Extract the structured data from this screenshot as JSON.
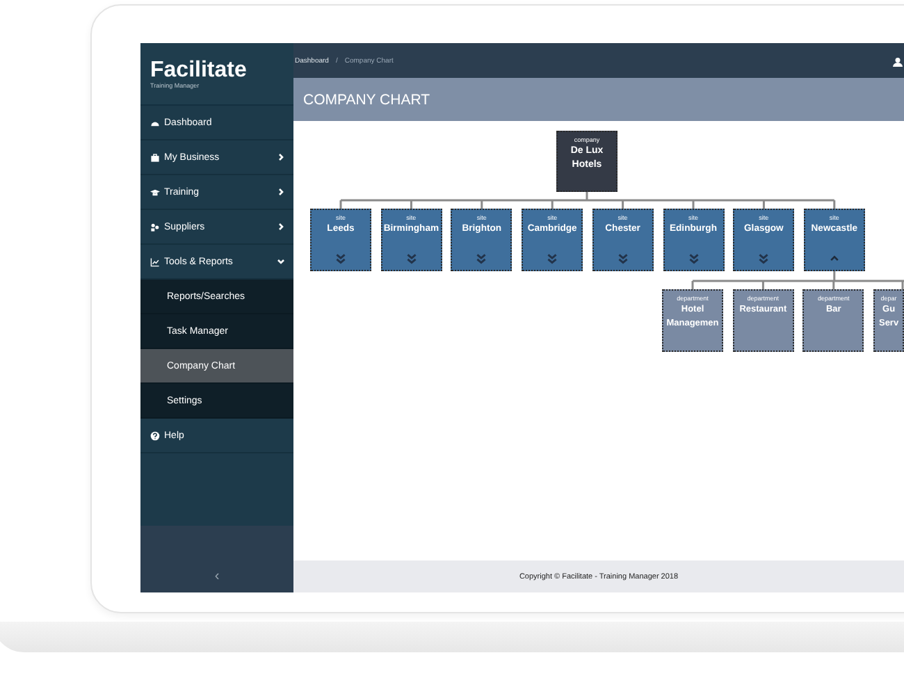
{
  "logo": {
    "name": "Facilitate",
    "subtitle": "Training Manager"
  },
  "sidebar": {
    "items": [
      {
        "label": "Dashboard"
      },
      {
        "label": "My Business",
        "expanded": false
      },
      {
        "label": "Training",
        "expanded": false
      },
      {
        "label": "Suppliers",
        "expanded": false
      },
      {
        "label": "Tools & Reports",
        "expanded": true,
        "children": [
          {
            "label": "Reports/Searches",
            "selected": false
          },
          {
            "label": "Task Manager",
            "selected": false
          },
          {
            "label": "Company Chart",
            "selected": true
          },
          {
            "label": "Settings",
            "selected": false
          }
        ]
      },
      {
        "label": "Help"
      }
    ],
    "collapse": "‹"
  },
  "breadcrumb": [
    "Dashboard",
    "/",
    "Company Chart"
  ],
  "page_title": "COMPANY CHART",
  "chart": {
    "company": {
      "kind": "company",
      "tag": "company",
      "name": "De Lux Hotels"
    },
    "sites": [
      {
        "kind": "site",
        "tag": "site",
        "name": "Leeds",
        "expanded": false
      },
      {
        "kind": "site",
        "tag": "site",
        "name": "Birmingham",
        "expanded": false
      },
      {
        "kind": "site",
        "tag": "site",
        "name": "Brighton",
        "expanded": false
      },
      {
        "kind": "site",
        "tag": "site",
        "name": "Cambridge",
        "expanded": false
      },
      {
        "kind": "site",
        "tag": "site",
        "name": "Chester",
        "expanded": false
      },
      {
        "kind": "site",
        "tag": "site",
        "name": "Edinburgh",
        "expanded": false
      },
      {
        "kind": "site",
        "tag": "site",
        "name": "Glasgow",
        "expanded": false
      },
      {
        "kind": "site",
        "tag": "site",
        "name": "Newcastle",
        "expanded": true,
        "children": [
          {
            "kind": "department",
            "tag": "department",
            "name": "Hotel Managemen"
          },
          {
            "kind": "department",
            "tag": "department",
            "name": "Restaurant"
          },
          {
            "kind": "department",
            "tag": "department",
            "name": "Bar"
          },
          {
            "kind": "department",
            "tag": "depar",
            "name": "Gu Serv"
          }
        ]
      }
    ]
  },
  "footer": "Copyright © Facilitate - Training Manager 2018"
}
